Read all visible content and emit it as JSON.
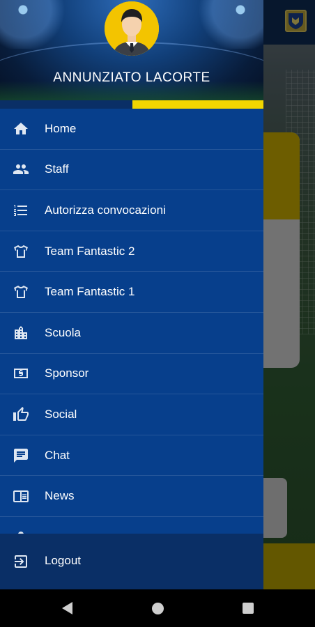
{
  "drawer": {
    "user_name": "ANNUNZIATO LACORTE",
    "menu": [
      {
        "label": "Home",
        "icon": "home-icon"
      },
      {
        "label": "Staff",
        "icon": "people-icon"
      },
      {
        "label": "Autorizza convocazioni",
        "icon": "list-icon"
      },
      {
        "label": "Team Fantastic 2",
        "icon": "shirt-icon"
      },
      {
        "label": "Team Fantastic 1",
        "icon": "shirt-icon"
      },
      {
        "label": "Scuola",
        "icon": "building-icon"
      },
      {
        "label": "Sponsor",
        "icon": "money-icon"
      },
      {
        "label": "Social",
        "icon": "thumb-up-icon"
      },
      {
        "label": "Chat",
        "icon": "chat-icon"
      },
      {
        "label": "News",
        "icon": "news-icon"
      }
    ],
    "logout_label": "Logout"
  },
  "colors": {
    "drawer_bg": "#073f8c",
    "accent_yellow": "#f2d600",
    "footer_bg": "#0a2f66"
  }
}
